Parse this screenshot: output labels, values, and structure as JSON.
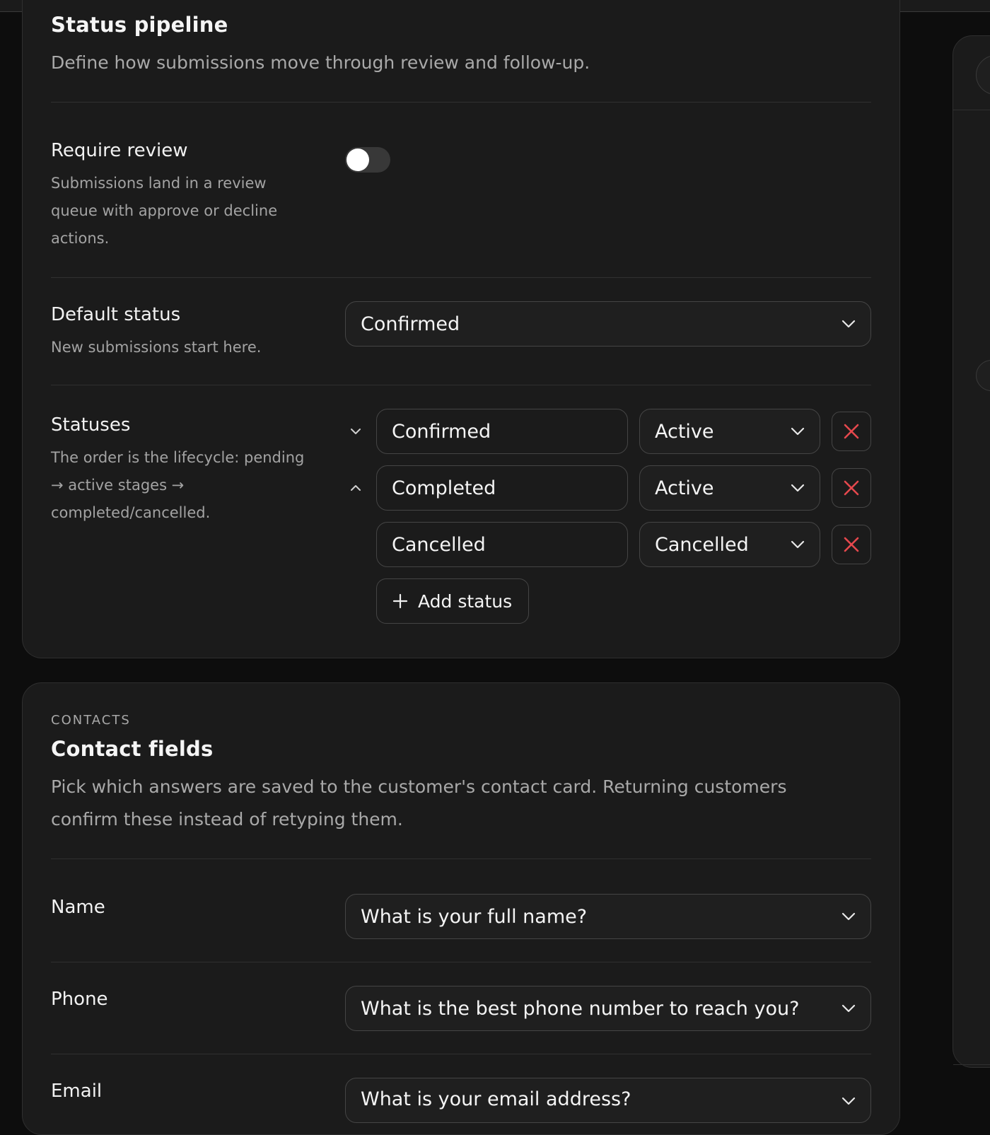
{
  "pipeline": {
    "title": "Status pipeline",
    "subtitle": "Define how submissions move through review and follow-up.",
    "require_review": {
      "label": "Require review",
      "description": "Submissions land in a review queue with approve or decline actions.",
      "enabled": false
    },
    "default_status": {
      "label": "Default status",
      "description": "New submissions start here.",
      "value": "Confirmed"
    },
    "statuses": {
      "label": "Statuses",
      "description": "The order is the lifecycle: pending → active stages → completed/cancelled.",
      "rows": [
        {
          "name": "Confirmed",
          "type": "Active",
          "reorder": "chevron-down-icon"
        },
        {
          "name": "Completed",
          "type": "Active",
          "reorder": "chevron-up-icon"
        },
        {
          "name": "Cancelled",
          "type": "Cancelled",
          "reorder": ""
        }
      ],
      "add_label": "Add status"
    }
  },
  "contacts": {
    "eyebrow": "CONTACTS",
    "title": "Contact fields",
    "subtitle": "Pick which answers are saved to the customer's contact card. Returning customers confirm these instead of retyping them.",
    "fields": [
      {
        "label": "Name",
        "value": "What is your full name?"
      },
      {
        "label": "Phone",
        "value": "What is the best phone number to reach you?"
      },
      {
        "label": "Email",
        "value": "What is your email address?"
      }
    ]
  },
  "colors": {
    "background": "#0d0d0d",
    "card": "#1b1b1b",
    "border": "#454545",
    "danger": "#e5484d",
    "muted_text": "#a3a3a3"
  }
}
